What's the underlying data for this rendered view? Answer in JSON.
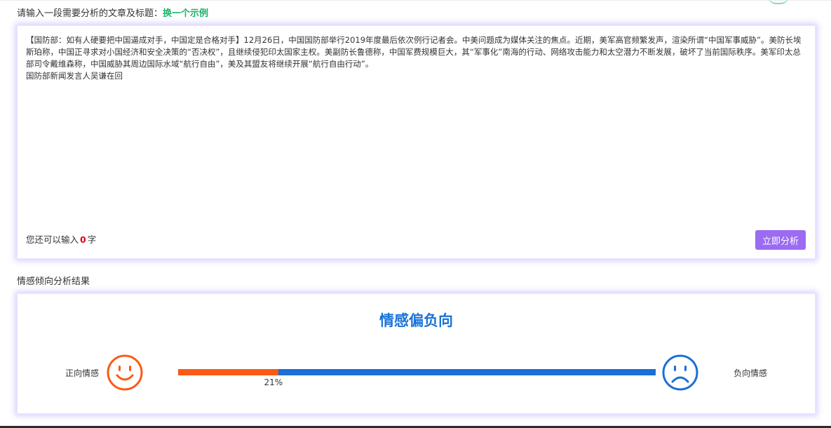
{
  "header": {
    "prompt": "请输入一段需要分析的文章及标题：",
    "example_link": "换一个示例"
  },
  "input": {
    "text": "【国防部：如有人硬要把中国逼成对手，中国定是合格对手】12月26日，中国国防部举行2019年度最后依次例行记者会。中美问题成为媒体关注的焦点。近期，美军高官频繁发声，渲染所谓“中国军事威胁”。美防长埃斯珀称，中国正寻求对小国经济和安全决策的“否决权”，且继续侵犯印太国家主权。美副防长鲁德称，中国军费规模巨大，其“军事化”南海的行动、网络攻击能力和太空潜力不断发展，破坏了当前国际秩序。美军印太总部司令戴维森称，中国威胁其周边国际水域“航行自由”，美及其盟友将继续开展“航行自由行动”。\n国防部新闻发言人吴谦在回",
    "remain_prefix": "您还可以输入",
    "remain_count": "0",
    "remain_suffix": "字",
    "analyze_button": "立即分析"
  },
  "result": {
    "heading": "情感倾向分析结果",
    "verdict": "情感偏负向",
    "positive_label": "正向情感",
    "negative_label": "负向情感",
    "positive_percent_text": "21%",
    "positive_fraction": 0.21,
    "colors": {
      "positive": "#fb5a16",
      "negative": "#1a6fd8",
      "verdict": "#1a73d9"
    },
    "icons": {
      "positive": "smile-icon",
      "negative": "sad-icon"
    }
  },
  "colors": {
    "accent_button": "#9b6bf2",
    "link_green": "#19b36b",
    "count_red": "#e60012"
  }
}
